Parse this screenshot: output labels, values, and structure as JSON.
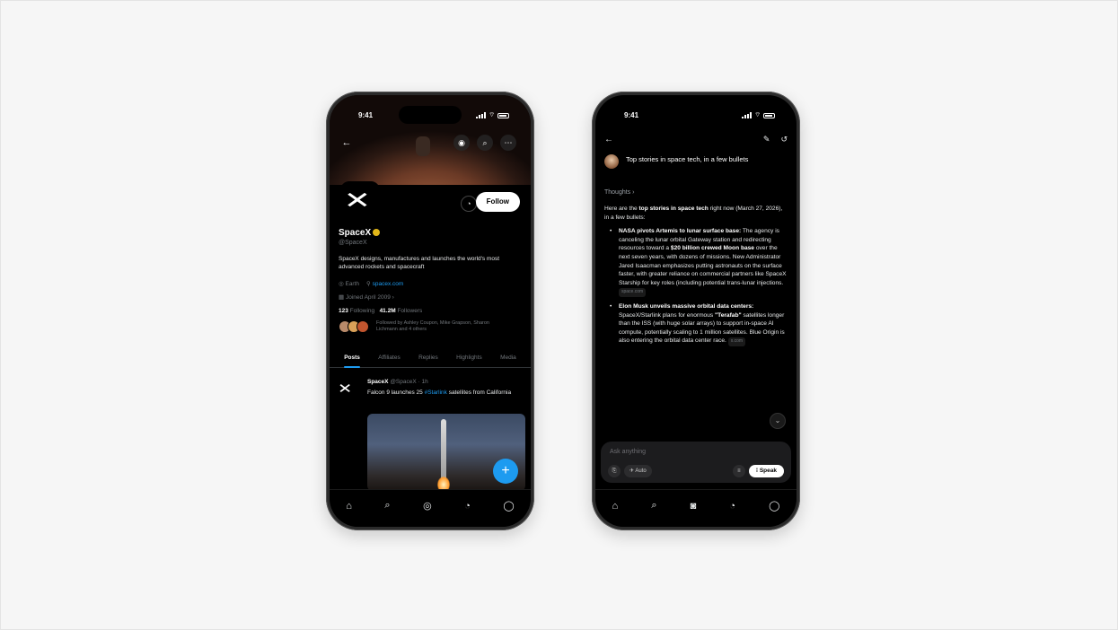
{
  "left_phone": {
    "status_time": "9:41",
    "profile": {
      "name": "SpaceX",
      "handle": "@SpaceX",
      "bio": "SpaceX designs, manufactures and launches the world's most advanced rockets and spacecraft",
      "location": "Earth",
      "website": "spacex.com",
      "joined": "Joined April 2009",
      "following_count": "123",
      "following_label": "Following",
      "followers_count": "41.2M",
      "followers_label": "Followers",
      "followed_by": "Followed by Ashley Coupon, Mike Grapson, Sharon Lichmann and 4 others"
    },
    "follow_label": "Follow",
    "tabs": [
      "Posts",
      "Affiliates",
      "Replies",
      "Highlights",
      "Media"
    ],
    "post": {
      "author": "SpaceX",
      "author_handle": "@SpaceX · 1h",
      "text_pre": "Falcon 9 launches 25 ",
      "mention": "#Starlink",
      "text_post": " satellites from California"
    }
  },
  "right_phone": {
    "status_time": "9:41",
    "query": "Top stories in space tech, in a few bullets",
    "thoughts_label": "Thoughts ›",
    "intro": {
      "pre": "Here are the ",
      "bold": "top stories in space tech",
      "post": " right now (March 27, 2026), in a few bullets:"
    },
    "bullets": [
      {
        "title": "NASA pivots Artemis to lunar surface base:",
        "p1": " The agency is canceling the lunar orbital Gateway station and redirecting resources toward a ",
        "bold2": "$20 billion crewed Moon base",
        "p2": " over the next seven years, with dozens of missions. New Administrator Jared Isaacman emphasizes putting astronauts on the surface faster, with greater reliance on commercial partners like SpaceX Starship for key roles (including potential trans-lunar injections.",
        "source": "space.com"
      },
      {
        "title": "Elon Musk unveils massive orbital data centers:",
        "p1": " SpaceX/Starlink plans for enormous ",
        "bold2": "\"Terafab\"",
        "p2": " satellites longer than the ISS (with huge solar arrays) to support in-space AI compute, potentially scaling to 1 million satellites. Blue Origin is also entering the orbital data center race.",
        "source": "x.com"
      }
    ],
    "composer_placeholder": "Ask anything",
    "auto_label": "Auto",
    "speak_label": "Speak"
  }
}
